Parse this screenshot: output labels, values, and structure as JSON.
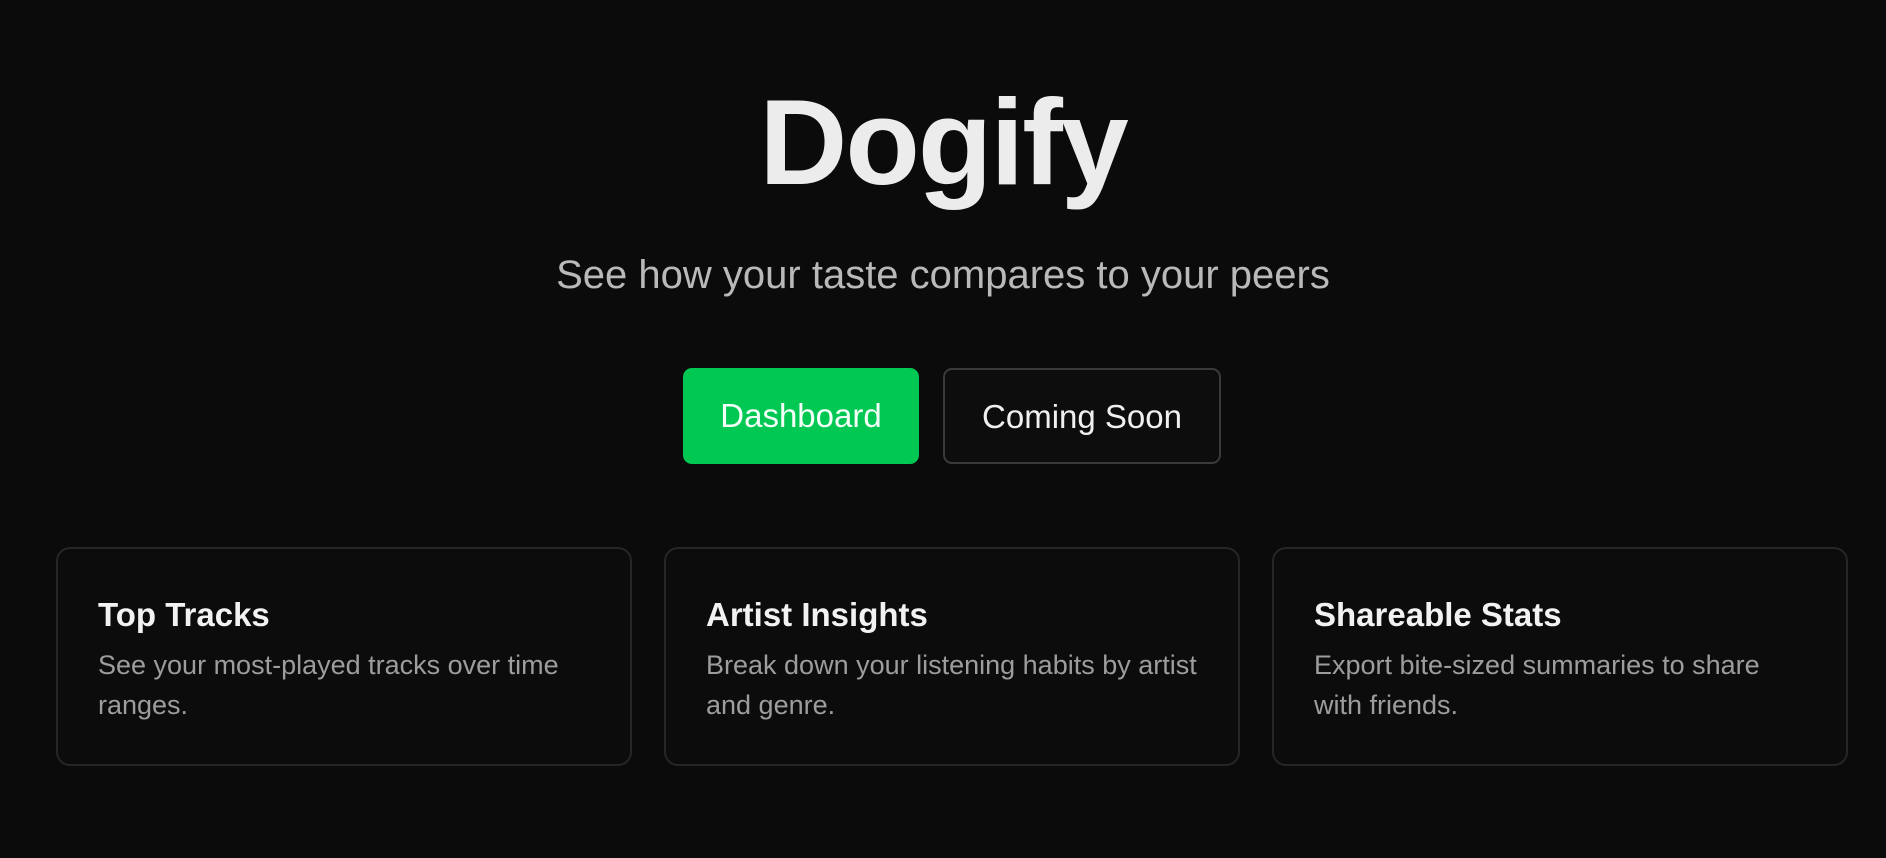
{
  "hero": {
    "title": "Dogify",
    "subtitle": "See how your taste compares to your peers"
  },
  "actions": {
    "primary_label": "Dashboard",
    "secondary_label": "Coming Soon"
  },
  "features": [
    {
      "title": "Top Tracks",
      "description": "See your most-played tracks over time ranges."
    },
    {
      "title": "Artist Insights",
      "description": "Break down your listening habits by artist and genre."
    },
    {
      "title": "Shareable Stats",
      "description": "Export bite-sized summaries to share with friends."
    }
  ],
  "colors": {
    "background": "#0b0b0b",
    "accent": "#00c853",
    "card_border": "#262626"
  }
}
